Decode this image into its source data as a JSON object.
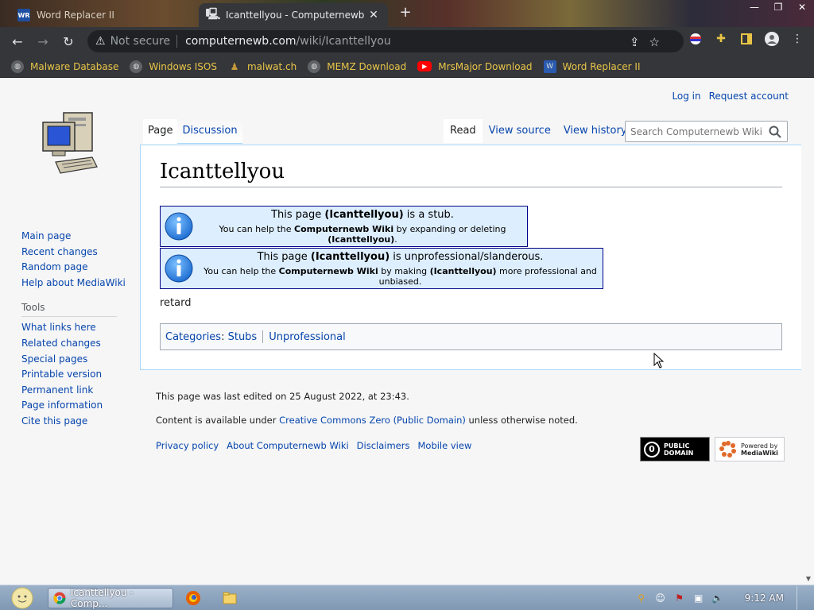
{
  "browser": {
    "tabs": [
      {
        "title": "Word Replacer II",
        "active": false
      },
      {
        "title": "Icanttellyou - Computernewb Wiki",
        "active": true
      }
    ],
    "new_tab": "+",
    "window_controls": {
      "minimize": "—",
      "maximize": "❐",
      "close": "✕"
    },
    "omnibox": {
      "security": "Not secure",
      "domain": "computernewb.com",
      "path": "/wiki/Icanttellyou"
    },
    "bookmarks": [
      {
        "label": "Malware Database",
        "icon": "globe-icon"
      },
      {
        "label": "Windows ISOS",
        "icon": "globe-icon"
      },
      {
        "label": "malwat.ch",
        "icon": "malwatch-icon"
      },
      {
        "label": "MEMZ Download",
        "icon": "globe-icon"
      },
      {
        "label": "MrsMajor Download",
        "icon": "youtube-icon"
      },
      {
        "label": "Word Replacer II",
        "icon": "word-replacer-icon"
      }
    ]
  },
  "wiki": {
    "personal": {
      "login": "Log in",
      "request": "Request account"
    },
    "tabs_left": [
      {
        "label": "Page",
        "selected": true
      },
      {
        "label": "Discussion",
        "selected": false
      }
    ],
    "tabs_right": [
      {
        "label": "Read",
        "selected": true
      },
      {
        "label": "View source",
        "selected": false
      },
      {
        "label": "View history",
        "selected": false
      }
    ],
    "search": {
      "placeholder": "Search Computernewb Wiki"
    },
    "sidebar": {
      "navigation": [
        "Main page",
        "Recent changes",
        "Random page",
        "Help about MediaWiki"
      ],
      "tools_title": "Tools",
      "tools": [
        "What links here",
        "Related changes",
        "Special pages",
        "Printable version",
        "Permanent link",
        "Page information",
        "Cite this page"
      ]
    },
    "title": "Icanttellyou",
    "notices": [
      {
        "line1_pre": "This page ",
        "line1_bold": "(Icanttellyou)",
        "line1_post": " is a stub.",
        "line2_pre": "You can help the ",
        "line2_bold1": "Computernewb Wiki",
        "line2_mid": " by expanding or deleting ",
        "line2_bold2": "(Icanttellyou)",
        "line2_post": "."
      },
      {
        "line1_pre": "This page ",
        "line1_bold": "(Icanttellyou)",
        "line1_post": " is unprofessional/slanderous.",
        "line2_pre": "You can help the ",
        "line2_bold1": "Computernewb Wiki",
        "line2_mid": " by making ",
        "line2_bold2": "(Icanttellyou)",
        "line2_post": " more professional and unbiased."
      }
    ],
    "body": "retard",
    "categories": {
      "label": "Categories",
      "items": [
        "Stubs",
        "Unprofessional"
      ]
    },
    "footer": {
      "last_edited": "This page was last edited on 25 August 2022, at 23:43.",
      "license_pre": "Content is available under ",
      "license_link": "Creative Commons Zero (Public Domain)",
      "license_post": " unless otherwise noted.",
      "links": [
        "Privacy policy",
        "About Computernewb Wiki",
        "Disclaimers",
        "Mobile view"
      ],
      "badge_pd": [
        "PUBLIC",
        "DOMAIN"
      ],
      "badge_mw": [
        "Powered by",
        "MediaWiki"
      ]
    }
  },
  "taskbar": {
    "task_title": "Icanttellyou - Comp...",
    "clock": "9:12 AM"
  },
  "colors": {
    "link": "#0645ad",
    "notice_bg": "#ddeeff",
    "notice_border": "#000088",
    "bookmark_text": "#e8c547"
  }
}
